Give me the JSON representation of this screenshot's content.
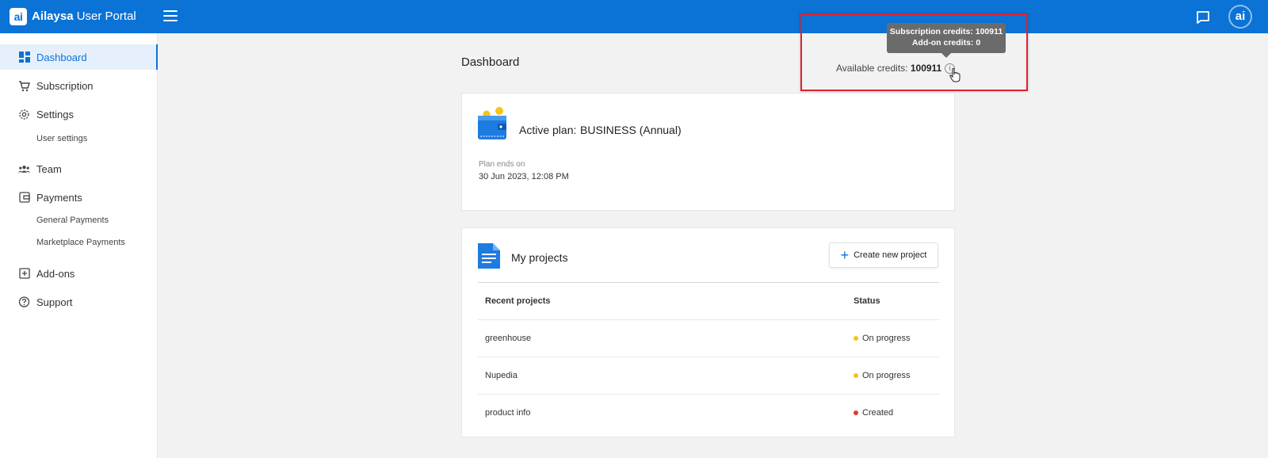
{
  "header": {
    "logo_text": "ai",
    "brand_name": "Ailaysa",
    "brand_suffix": "User Portal",
    "avatar_text": "ai"
  },
  "sidebar": {
    "items": [
      {
        "label": "Dashboard",
        "icon": "dashboard-icon",
        "active": true
      },
      {
        "label": "Subscription",
        "icon": "cart-icon"
      },
      {
        "label": "Settings",
        "icon": "gear-icon",
        "children": [
          "User settings"
        ]
      },
      {
        "label": "Team",
        "icon": "team-icon"
      },
      {
        "label": "Payments",
        "icon": "wallet-icon",
        "children": [
          "General Payments",
          "Marketplace Payments"
        ]
      },
      {
        "label": "Add-ons",
        "icon": "plus-box-icon"
      },
      {
        "label": "Support",
        "icon": "help-icon"
      }
    ]
  },
  "main": {
    "title": "Dashboard",
    "credits_label": "Available credits:",
    "credits_value": "100911",
    "tooltip": {
      "line1": "Subscription credits: 100911",
      "line2": "Add-on credits: 0"
    },
    "plan": {
      "label": "Active plan:",
      "value": "BUSINESS (Annual)",
      "ends_label": "Plan ends on",
      "ends_value": "30 Jun 2023, 12:08 PM"
    },
    "projects": {
      "title": "My projects",
      "create_label": "Create new project",
      "columns": [
        "Recent projects",
        "Status"
      ],
      "rows": [
        {
          "name": "greenhouse",
          "status": "On progress",
          "status_color": "#f5c518"
        },
        {
          "name": "Nupedia",
          "status": "On progress",
          "status_color": "#f5c518"
        },
        {
          "name": "product info",
          "status": "Created",
          "status_color": "#e53935"
        }
      ]
    }
  },
  "colors": {
    "brand": "#0b72d6",
    "highlight": "#e0212f"
  }
}
